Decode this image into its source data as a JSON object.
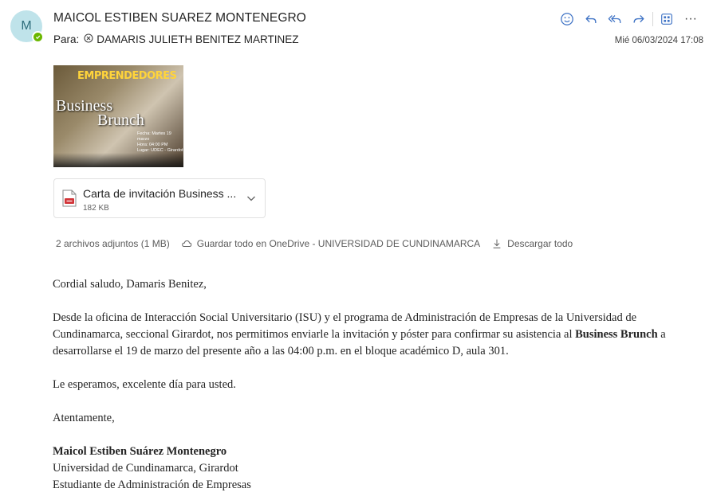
{
  "header": {
    "avatar_initial": "M",
    "sender_name": "MAICOL ESTIBEN SUAREZ MONTENEGRO",
    "to_label": "Para:",
    "recipient": "DAMARIS JULIETH BENITEZ MARTINEZ",
    "date": "Mié 06/03/2024 17:08",
    "presence_color": "#6bb700",
    "accent_color": "#3f73c5"
  },
  "toolbar": {
    "icons": [
      "emoji-icon",
      "reply-icon",
      "reply-all-icon",
      "forward-icon",
      "apps-icon",
      "more-icon"
    ],
    "more_label": "···"
  },
  "poster": {
    "title": "EMPRENDEDORES",
    "line1": "Business",
    "line2": "Brunch",
    "info1": "Fecha: Martes 19 marzo",
    "info2": "Hora: 04:00 PM",
    "info3": "Lugar: UDEC - Girardot"
  },
  "attachment": {
    "name": "Carta de invitación Business ...",
    "size": "182 KB",
    "icon": "pdf-icon"
  },
  "attachments_bar": {
    "summary": "2 archivos adjuntos (1 MB)",
    "save_label": "Guardar todo en OneDrive - UNIVERSIDAD DE CUNDINAMARCA",
    "download_label": "Descargar todo"
  },
  "message": {
    "greeting": "Cordial saludo, Damaris Benitez,",
    "para1_a": "Desde la oficina de Interacción Social Universitario (ISU) y el programa de Administración de Empresas de la Universidad de Cundinamarca, seccional Girardot, nos permitimos enviarle la invitación y póster para confirmar su asistencia al ",
    "para1_bold": "Business Brunch",
    "para1_b": " a desarrollarse el 19 de marzo del presente año a las 04:00 p.m. en el bloque académico D, aula 301.",
    "closing_wish": "Le esperamos, excelente día para usted.",
    "sign_off": "Atentamente,",
    "signature_name": "Maicol Estiben Suárez Montenegro",
    "signature_line1": "Universidad de Cundinamarca, Girardot",
    "signature_line2": "Estudiante de Administración de Empresas"
  }
}
